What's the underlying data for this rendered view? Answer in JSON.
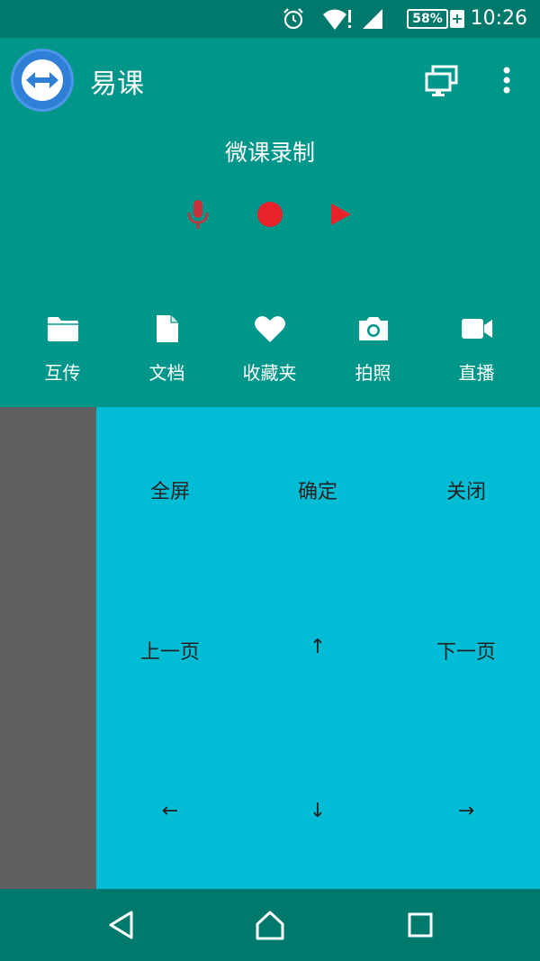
{
  "status_bar": {
    "battery": "58%",
    "battery_plus": "+",
    "time": "10:26"
  },
  "app_bar": {
    "title": "易课"
  },
  "recorder": {
    "title": "微课录制"
  },
  "quick_actions": [
    {
      "label": "互传",
      "icon": "folder-icon"
    },
    {
      "label": "文档",
      "icon": "document-icon"
    },
    {
      "label": "收藏夹",
      "icon": "heart-icon"
    },
    {
      "label": "拍照",
      "icon": "camera-icon"
    },
    {
      "label": "直播",
      "icon": "video-icon"
    }
  ],
  "remote_keys": {
    "fullscreen": "全屏",
    "confirm": "确定",
    "close": "关闭",
    "prev_page": "上一页",
    "up": "↑",
    "next_page": "下一页",
    "left": "←",
    "down": "↓",
    "right": "→"
  },
  "colors": {
    "primary": "#00968a",
    "primary_dark": "#00796d",
    "remote_bg": "#00bcd5",
    "drawer_bg": "#5f5f5f",
    "record_red": "#e8222a",
    "mic_red": "#c8323a"
  }
}
